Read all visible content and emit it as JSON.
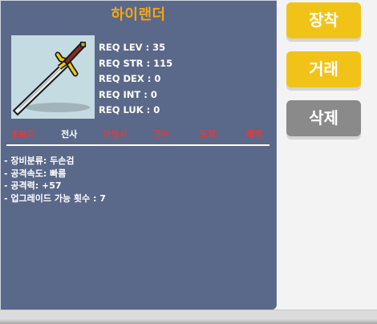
{
  "item": {
    "name": "하이랜더",
    "icon": "two-handed-sword-icon"
  },
  "requirements": [
    "REQ LEV : 35",
    "REQ STR : 115",
    "REQ DEX : 0",
    "REQ INT : 0",
    "REQ LUK : 0"
  ],
  "jobs": [
    {
      "label": "초보자",
      "allowed": false
    },
    {
      "label": "전사",
      "allowed": true
    },
    {
      "label": "마법사",
      "allowed": false
    },
    {
      "label": "궁수",
      "allowed": false
    },
    {
      "label": "도적",
      "allowed": false
    },
    {
      "label": "해적",
      "allowed": false
    }
  ],
  "properties": [
    "- 장비분류: 두손검",
    "- 공격속도: 빠름",
    "- 공격력: +57",
    "- 업그레이드 가능 횟수 : 7"
  ],
  "buttons": {
    "equip": "장착",
    "trade": "거래",
    "delete": "삭제"
  },
  "colors": {
    "panel": "#5a6889",
    "title": "#f2a618",
    "job_disabled": "#e33a3a",
    "job_enabled": "#ffffff",
    "button_primary": "#f1c318",
    "button_secondary": "#8a8a8a"
  }
}
